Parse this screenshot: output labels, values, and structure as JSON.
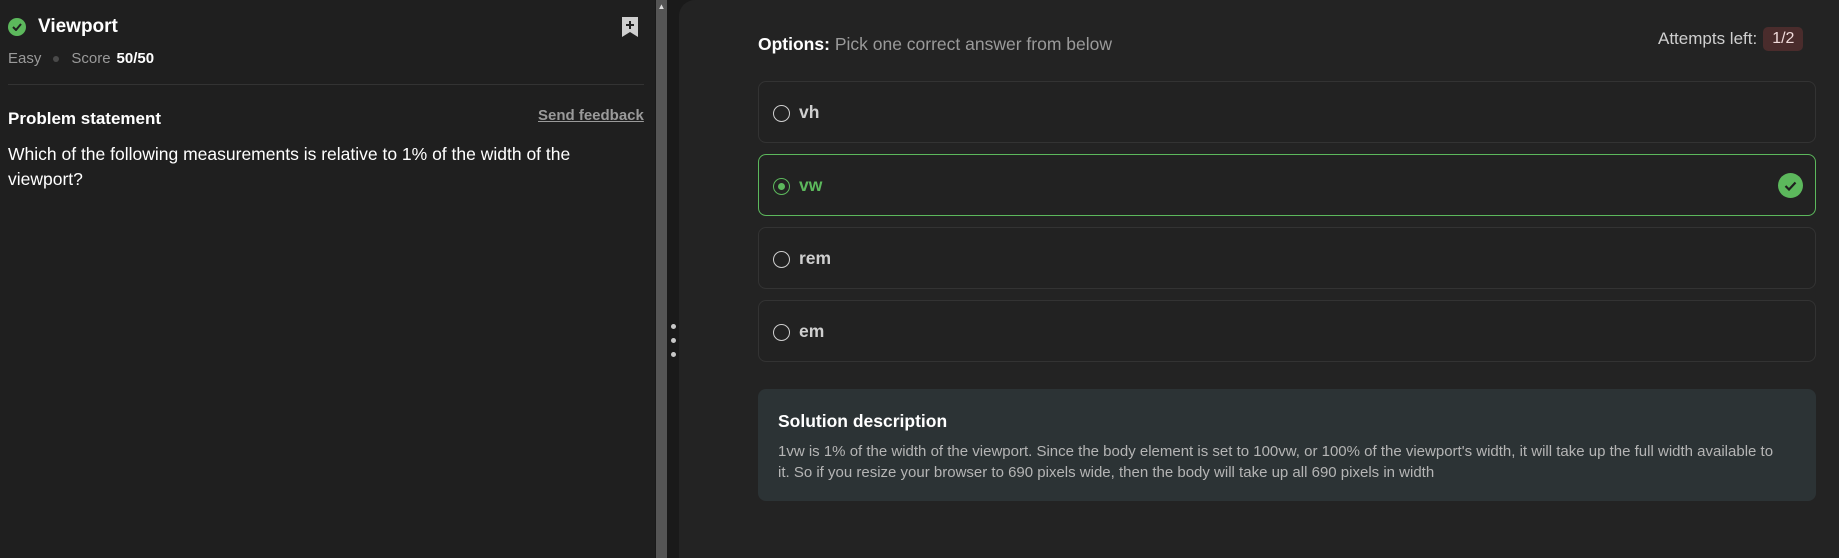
{
  "problem": {
    "title": "Viewport",
    "difficulty": "Easy",
    "score_label": "Score",
    "score_value": "50/50",
    "statement_heading": "Problem statement",
    "feedback_link": "Send feedback",
    "question": "Which of the following measurements is relative to 1% of the width of the viewport?"
  },
  "options": {
    "header_label": "Options:",
    "header_hint": "Pick one correct answer from below",
    "attempts_label": "Attempts left:",
    "attempts_value": "1/2",
    "items": [
      {
        "label": "vh",
        "selected": false
      },
      {
        "label": "vw",
        "selected": true,
        "correct": true
      },
      {
        "label": "rem",
        "selected": false
      },
      {
        "label": "em",
        "selected": false
      }
    ]
  },
  "solution": {
    "title": "Solution description",
    "text": "1vw is 1% of the width of the viewport. Since the body element is set to 100vw, or 100% of the viewport's width, it will take up the full width available to it. So if you resize your browser to 690 pixels wide, then the body will take up all 690 pixels in width"
  },
  "colors": {
    "success": "#5cb85c",
    "attempts_badge": "#4a2c2c",
    "solution_bg": "#2c3335"
  },
  "icons": [
    "check-circle-icon",
    "bookmark-add-icon",
    "drag-handle-icon",
    "scroll-up-arrow-icon"
  ]
}
